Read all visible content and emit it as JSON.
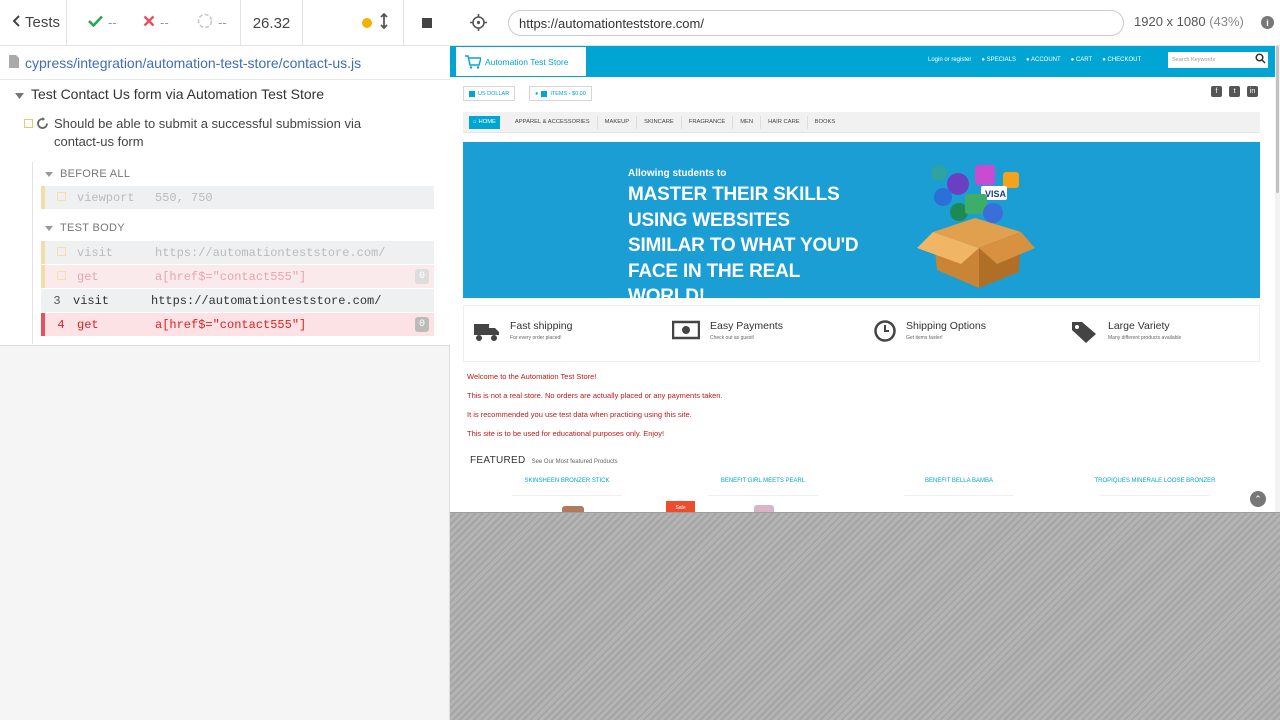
{
  "reporter": {
    "back_label": "Tests",
    "passed": "--",
    "failed": "--",
    "pending": "--",
    "duration": "26.32",
    "spec_path": "cypress/integration/automation-test-store/contact-us.js",
    "suite_title": "Test Contact Us form via Automation Test Store",
    "test_title": "Should be able to submit a successful submission via contact-us form",
    "before_all_label": "BEFORE ALL",
    "test_body_label": "TEST BODY",
    "commands": [
      {
        "num": "",
        "name": "viewport",
        "arg": "550, 750",
        "badge": ""
      },
      {
        "num": "",
        "name": "visit",
        "arg": "https://automationteststore.com/",
        "badge": ""
      },
      {
        "num": "",
        "name": "get",
        "arg": "a[href$=\"contact555\"]",
        "badge": "0"
      },
      {
        "num": "3",
        "name": "visit",
        "arg": "https://automationteststore.com/",
        "badge": ""
      },
      {
        "num": "4",
        "name": "get",
        "arg": "a[href$=\"contact555\"]",
        "badge": "0"
      }
    ]
  },
  "aut": {
    "url": "https://automationteststore.com/",
    "viewport": "1920 x 1080",
    "scale": "(43%)"
  },
  "site": {
    "logo": "Automation Test Store",
    "top_links": [
      "Login or register",
      "SPECIALS",
      "ACCOUNT",
      "CART",
      "CHECKOUT"
    ],
    "search_placeholder": "Search Keywords",
    "currency": "US DOLLAR",
    "cart_items": "ITEMS - $0.00",
    "nav": [
      "HOME",
      "APPAREL & ACCESSORIES",
      "MAKEUP",
      "SKINCARE",
      "FRAGRANCE",
      "MEN",
      "HAIR CARE",
      "BOOKS"
    ],
    "banner_small": "Allowing students to",
    "banner_big": "MASTER THEIR SKILLS USING WEBSITES SIMILAR TO WHAT YOU'D FACE IN THE REAL WORLD!",
    "features": [
      {
        "title": "Fast shipping",
        "sub": "For every order placed!"
      },
      {
        "title": "Easy Payments",
        "sub": "Check out as guest!"
      },
      {
        "title": "Shipping Options",
        "sub": "Get items faster!"
      },
      {
        "title": "Large Variety",
        "sub": "Many different products available"
      }
    ],
    "messages": [
      "Welcome to the Automation Test Store!",
      "This is not a real store. No orders are actually placed or any payments taken.",
      "It is recommended you use test data when practicing using this site.",
      "This site is to be used for educational purposes only. Enjoy!"
    ],
    "featured_title": "FEATURED",
    "featured_sub": "See Our Most featured Products",
    "products": [
      "SKINSHEEN BRONZER STICK",
      "BENEFIT GIRL MEETS PEARL",
      "BENEFIT BELLA BAMBA",
      "TROPIQUES MINERALE LOOSE BRONZER"
    ],
    "sale_label": "Sale"
  },
  "colors": {
    "brand": "#00a5d4",
    "pass": "#2ea44f",
    "fail": "#e94f5f",
    "warn": "#f0b400",
    "message": "#c01818"
  }
}
